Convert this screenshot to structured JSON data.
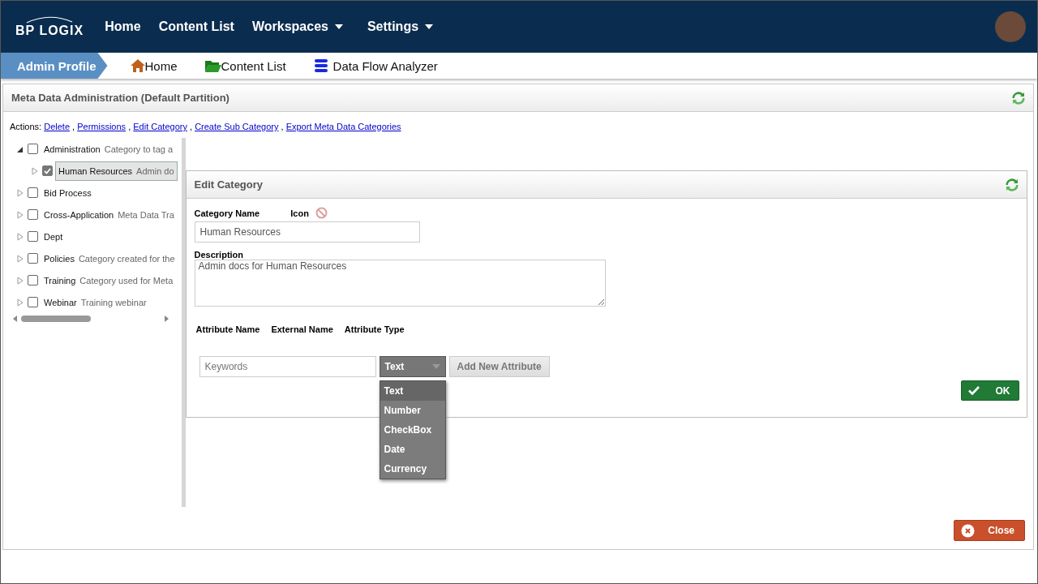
{
  "nav": {
    "logo": "BP LOGIX",
    "items": [
      {
        "label": "Home",
        "has_menu": false
      },
      {
        "label": "Content List",
        "has_menu": false
      },
      {
        "label": "Workspaces",
        "has_menu": true
      },
      {
        "label": "Settings",
        "has_menu": true
      }
    ]
  },
  "breadcrumb": {
    "current": "Admin Profile",
    "links": [
      {
        "label": "Home",
        "kind": "home"
      },
      {
        "label": "Content List",
        "kind": "folder"
      },
      {
        "label": "Data Flow Analyzer",
        "kind": "database"
      }
    ]
  },
  "page": {
    "title": "Meta Data Administration (Default Partition)",
    "actions_label": "Actions:",
    "separator": ",",
    "actions": [
      "Delete",
      "Permissions",
      "Edit Category",
      "Create Sub Category",
      "Export Meta Data Categories"
    ]
  },
  "tree": [
    {
      "name": "Administration",
      "description": "Category to tag a",
      "checked": false,
      "selected": false,
      "expanded": true,
      "children": [
        {
          "name": "Human Resources",
          "description": "Admin do",
          "checked": true,
          "selected": true,
          "expanded": false
        }
      ]
    },
    {
      "name": "Bid Process",
      "checked": false,
      "selected": false,
      "expanded": false
    },
    {
      "name": "Cross-Application",
      "description": "Meta Data Tra",
      "checked": false,
      "selected": false,
      "expanded": false
    },
    {
      "name": "Dept",
      "checked": false,
      "selected": false,
      "expanded": false
    },
    {
      "name": "Policies",
      "description": "Category created for the",
      "checked": false,
      "selected": false,
      "expanded": false
    },
    {
      "name": "Training",
      "description": "Category used for Meta",
      "checked": false,
      "selected": false,
      "expanded": false
    },
    {
      "name": "Webinar",
      "description": "Training webinar",
      "checked": false,
      "selected": false,
      "expanded": false
    }
  ],
  "edit": {
    "title": "Edit Category",
    "category_name_label": "Category Name",
    "icon_label": "Icon",
    "category_name": "Human Resources",
    "description_label": "Description",
    "description": "Admin docs for Human Resources",
    "attribute_columns": [
      "Attribute Name",
      "External Name",
      "Attribute Type"
    ],
    "new_attribute": {
      "placeholder": "Keywords",
      "type": "Text",
      "type_options": [
        {
          "label": "Text",
          "selected": true
        },
        {
          "label": "Number",
          "selected": false
        },
        {
          "label": "CheckBox",
          "selected": false
        },
        {
          "label": "Date",
          "selected": false
        },
        {
          "label": "Currency",
          "selected": false
        }
      ]
    },
    "add_button": "Add New Attribute",
    "ok_button": "OK"
  },
  "close_button": "Close"
}
